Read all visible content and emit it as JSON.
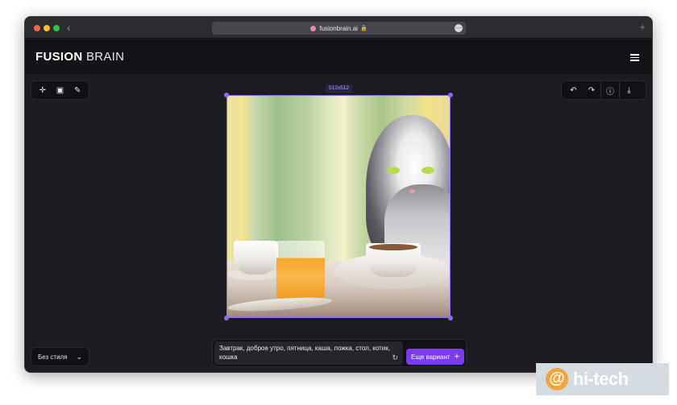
{
  "browser": {
    "url": "fusionbrain.ai",
    "icons": {
      "back": "chevron-left-icon",
      "lock": "lock-icon",
      "more": "more-icon",
      "new_tab": "plus-icon"
    }
  },
  "header": {
    "logo_bold": "FUSION",
    "logo_light": "BRAIN",
    "menu_icon": "hamburger-icon"
  },
  "toolbar_left": [
    {
      "icon": "move-icon",
      "glyph": "✥"
    },
    {
      "icon": "image-icon",
      "glyph": "🖼"
    },
    {
      "icon": "eraser-icon",
      "glyph": "⌫"
    }
  ],
  "toolbar_right": [
    {
      "icon": "undo-icon",
      "glyph": "↶"
    },
    {
      "icon": "redo-icon",
      "glyph": "↷"
    },
    {
      "icon": "help-icon",
      "glyph": "?"
    },
    {
      "icon": "download-icon",
      "glyph": "⤓"
    }
  ],
  "canvas": {
    "size_label": "512x512"
  },
  "style_select": {
    "value": "Без стиля"
  },
  "prompt": {
    "text": "Завтрак, доброе утро, пятница, каша, ложка, стол, котик, кошка",
    "generate_label": "Еще вариант"
  },
  "watermark": {
    "text": "hi-tech"
  },
  "colors": {
    "accent": "#7b3cf0",
    "selection": "#8b6bff",
    "background": "#1c1c22"
  }
}
